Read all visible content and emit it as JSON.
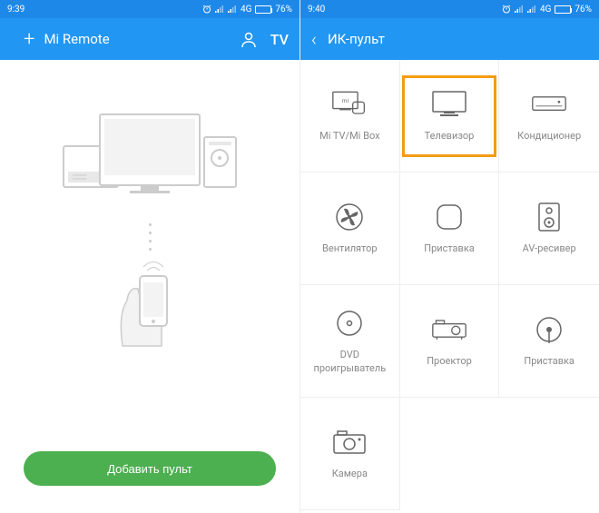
{
  "left": {
    "status": {
      "time": "9:39",
      "network": "4G",
      "battery": "76%"
    },
    "appbar": {
      "title": "Mi Remote"
    },
    "addButton": "Добавить пульт"
  },
  "right": {
    "status": {
      "time": "9:40",
      "network": "4G",
      "battery": "76%"
    },
    "appbar": {
      "title": "ИК-пульт"
    },
    "categories": [
      {
        "label": "Mi TV/Mi Box",
        "icon": "mitv",
        "selected": false
      },
      {
        "label": "Телевизор",
        "icon": "tv",
        "selected": true
      },
      {
        "label": "Кондиционер",
        "icon": "ac",
        "selected": false
      },
      {
        "label": "Вентилятор",
        "icon": "fan",
        "selected": false
      },
      {
        "label": "Приставка",
        "icon": "stb",
        "selected": false
      },
      {
        "label": "AV-ресивер",
        "icon": "av",
        "selected": false
      },
      {
        "label": "DVD проигрыватель",
        "icon": "dvd",
        "selected": false
      },
      {
        "label": "Проектор",
        "icon": "projector",
        "selected": false
      },
      {
        "label": "Приставка",
        "icon": "satellite",
        "selected": false
      },
      {
        "label": "Камера",
        "icon": "camera",
        "selected": false
      }
    ]
  }
}
